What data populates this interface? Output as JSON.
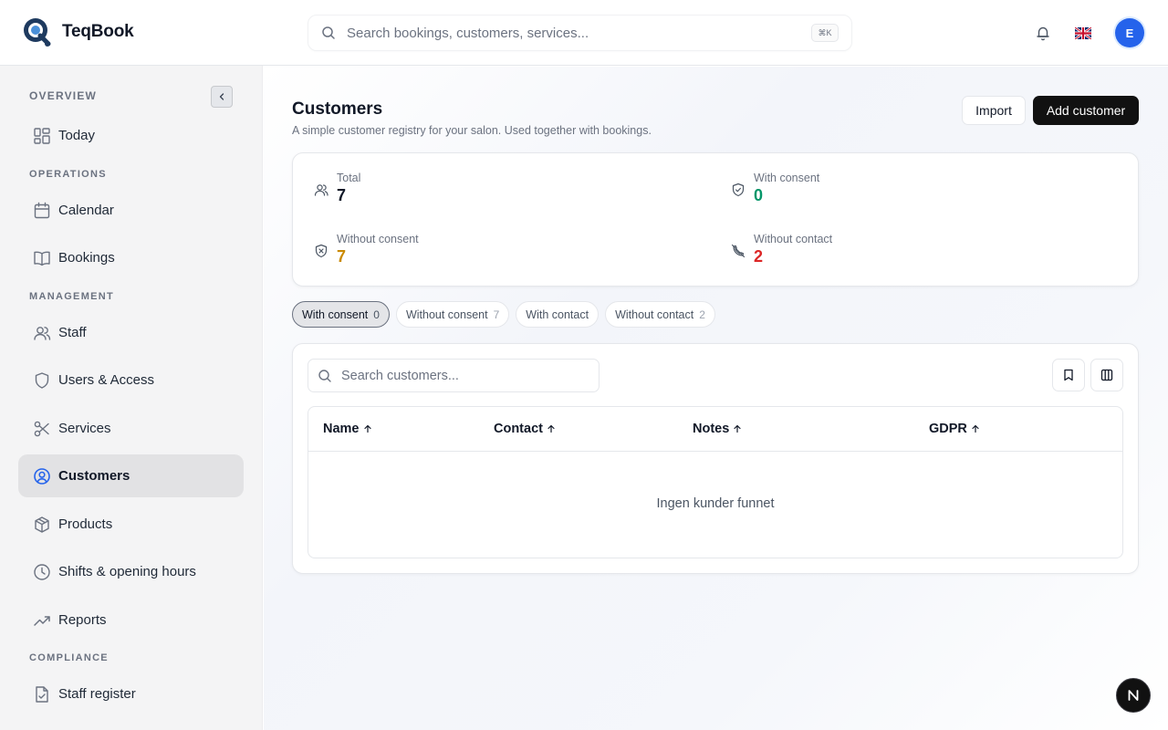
{
  "app": {
    "name": "TeqBook"
  },
  "header": {
    "search_placeholder": "Search bookings, customers, services...",
    "shortcut": "⌘K",
    "avatar_initial": "E",
    "language": "English (UK)"
  },
  "sidebar": {
    "sections": {
      "overview": "OVERVIEW",
      "operations": "OPERATIONS",
      "management": "MANAGEMENT",
      "compliance": "COMPLIANCE"
    },
    "items": {
      "today": "Today",
      "calendar": "Calendar",
      "bookings": "Bookings",
      "staff": "Staff",
      "users_access": "Users & Access",
      "services": "Services",
      "customers": "Customers",
      "products": "Products",
      "shifts": "Shifts & opening hours",
      "reports": "Reports",
      "staff_register": "Staff register"
    },
    "active_item": "Customers"
  },
  "page": {
    "title": "Customers",
    "subtitle": "A simple customer registry for your salon. Used together with bookings.",
    "import_label": "Import",
    "add_label": "Add customer"
  },
  "stats": {
    "total": {
      "label": "Total",
      "value": "7"
    },
    "with_consent": {
      "label": "With consent",
      "value": "0"
    },
    "without_consent": {
      "label": "Without consent",
      "value": "7"
    },
    "without_contact": {
      "label": "Without contact",
      "value": "2"
    }
  },
  "filters": [
    {
      "label": "With consent",
      "count": "0",
      "active": true
    },
    {
      "label": "Without consent",
      "count": "7",
      "active": false
    },
    {
      "label": "With contact",
      "count": "",
      "active": false
    },
    {
      "label": "Without contact",
      "count": "2",
      "active": false
    }
  ],
  "table": {
    "search_placeholder": "Search customers...",
    "columns": [
      "Name",
      "Contact",
      "Notes",
      "GDPR"
    ],
    "empty_text": "Ingen kunder funnet"
  },
  "colors": {
    "accent": "#2563eb",
    "success": "#059669",
    "warning": "#ca8a04",
    "danger": "#dc2626",
    "primary_button": "#111111"
  },
  "icons": {
    "fab": "next-logo-icon"
  }
}
